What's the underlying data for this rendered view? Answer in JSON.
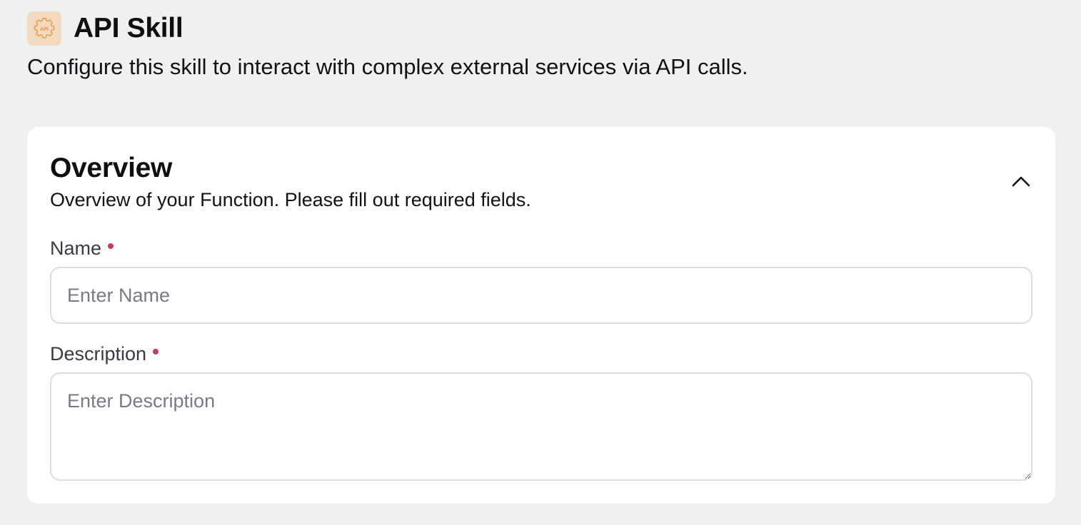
{
  "header": {
    "icon": "api-gear-icon",
    "icon_text": "API",
    "title": "API Skill",
    "description": "Configure this skill to interact with complex external services via API calls."
  },
  "overview": {
    "title": "Overview",
    "subtitle": "Overview of your Function. Please fill out required fields.",
    "collapse_icon": "chevron-up-icon",
    "fields": {
      "name": {
        "label": "Name",
        "placeholder": "Enter Name",
        "value": ""
      },
      "description": {
        "label": "Description",
        "placeholder": "Enter Description",
        "value": ""
      }
    }
  },
  "colors": {
    "page_background": "#eff0f2",
    "card_background": "#ffffff",
    "icon_background": "#f3d9bf",
    "icon_accent": "#e69a3c",
    "required_dot": "#c8385d"
  }
}
